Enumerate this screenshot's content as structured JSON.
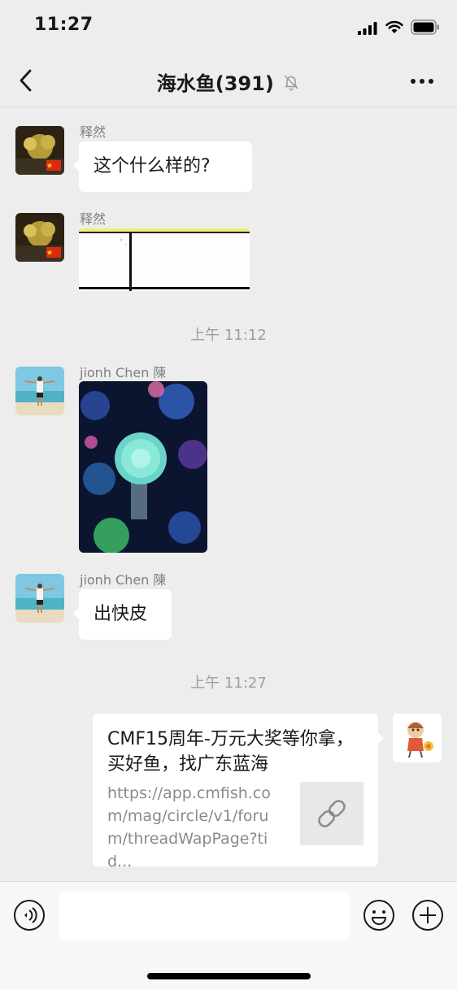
{
  "status_bar": {
    "time": "11:27"
  },
  "nav": {
    "title": "海水鱼(391)"
  },
  "messages": [
    {
      "sender": "释然",
      "text": "这个什么样的?"
    },
    {
      "sender": "释然"
    },
    {
      "sender": "jionh Chen 陳"
    },
    {
      "sender": "jionh Chen 陳",
      "text": "出快皮"
    }
  ],
  "timestamps": [
    "上午 11:12",
    "上午 11:27"
  ],
  "link_card": {
    "title": "CMF15周年-万元大奖等你拿，买好鱼，找广东蓝海",
    "url": "https://app.cmfish.com/mag/circle/v1/forum/threadWapPage?tid..."
  },
  "input": {
    "placeholder": ""
  },
  "icons": {
    "back": "chevron-left-icon",
    "mute": "bell-off-icon",
    "more": "ellipsis-icon",
    "voice": "voice-icon",
    "emoji": "emoji-icon",
    "plus": "plus-icon",
    "link": "link-icon"
  }
}
